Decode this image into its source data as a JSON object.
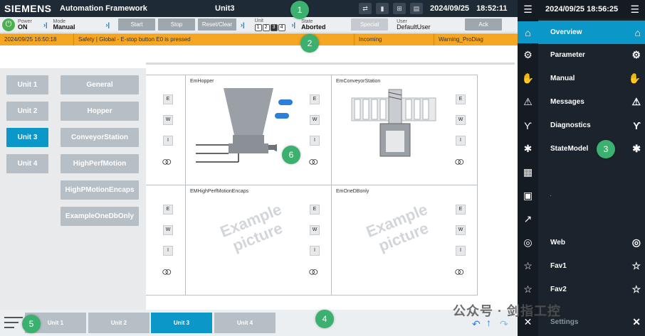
{
  "header": {
    "logo": "SIEMENS",
    "app_title": "Automation Framework",
    "unit_title": "Unit3",
    "date": "2024/09/25",
    "time": "18:52:11",
    "icons": [
      "network-icon",
      "device-icon",
      "topology-icon",
      "print-icon"
    ]
  },
  "statusbar": {
    "power_label": "Power",
    "power_value": "ON",
    "mode_label": "Mode",
    "mode_value": "Manual",
    "buttons": [
      "Start",
      "Stop",
      "Reset/Clear"
    ],
    "unit_label": "Unit",
    "unit_numbers": [
      "1",
      "2",
      "3",
      "4"
    ],
    "unit_selected": "3",
    "state_label": "State",
    "state_value": "Aborted",
    "special_label": "Special",
    "user_label": "User",
    "user_value": "DefaultUser",
    "ack_label": "Ack"
  },
  "alarm": {
    "timestamp": "2024/09/25 16:50:18",
    "message": "Safety |  Global - E-stop button E0  is pressed",
    "status": "Incoming",
    "class": "Warning_ProDiag"
  },
  "unit_panel": {
    "units": [
      "Unit 1",
      "Unit 2",
      "Unit 3",
      "Unit 4"
    ],
    "selected_unit": "Unit 3",
    "modules": [
      "General",
      "Hopper",
      "ConveyorStation",
      "HighPerfMotion",
      "HighPMotionEncaps",
      "ExampleOneDbOnly"
    ]
  },
  "equipment": {
    "cells": [
      {
        "title": "EmHopper"
      },
      {
        "title": "EmConveyorStation"
      },
      {
        "title": "EMHighPerfMotionEncaps"
      },
      {
        "title": "EmOneDBonly"
      }
    ],
    "ewi": [
      "E",
      "W",
      "I"
    ],
    "example_text_line1": "Example",
    "example_text_line2": "picture"
  },
  "bottombar": {
    "units": [
      "Unit 1",
      "Unit 2",
      "Unit 3",
      "Unit 4"
    ],
    "selected": "Unit 3"
  },
  "nav": {
    "datetime": "2024/09/25   18:56:25",
    "items": [
      "Overview",
      "Parameter",
      "Manual",
      "Messages",
      "Diagnostics",
      "StateModel",
      "Web",
      "Fav1",
      "Fav2",
      "Settings"
    ],
    "selected": "Overview",
    "dot": "."
  },
  "callouts": [
    "1",
    "2",
    "3",
    "4",
    "5",
    "6"
  ],
  "watermark": "公众号 · 剑指工控",
  "colors": {
    "header_bg": "#1e2a36",
    "accent": "#0c97c9",
    "alarm": "#f5a623",
    "callout": "#3cb06f",
    "button_gray": "#b7bfc6"
  }
}
